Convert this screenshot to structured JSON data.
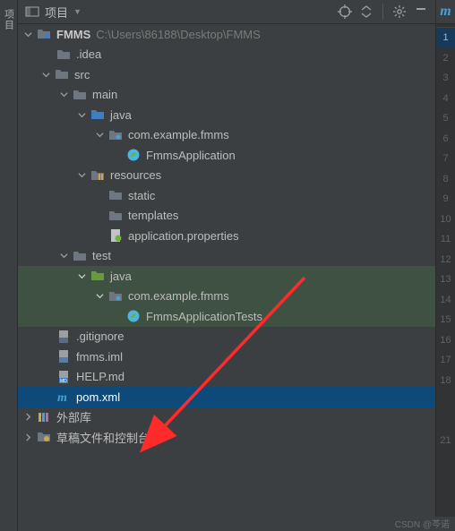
{
  "sidebar_tab": {
    "label": "项目"
  },
  "toolbar": {
    "title": "项目",
    "icons": {
      "project": "project-icon",
      "target": "target-icon",
      "expand": "expand-icon",
      "collapse": "collapse-icon",
      "settings": "gear-icon",
      "hide": "hide-icon"
    }
  },
  "gutter_tab": "m",
  "tree": {
    "root": {
      "name": "FMMS",
      "path": "C:\\Users\\86188\\Desktop\\FMMS",
      "children": [
        {
          "name": ".idea",
          "type": "dir"
        },
        {
          "name": "src",
          "type": "dir",
          "children": [
            {
              "name": "main",
              "type": "dir",
              "children": [
                {
                  "name": "java",
                  "type": "sourceRoot",
                  "children": [
                    {
                      "name": "com.example.fmms",
                      "type": "package",
                      "children": [
                        {
                          "name": "FmmsApplication",
                          "type": "springClass"
                        }
                      ]
                    }
                  ]
                },
                {
                  "name": "resources",
                  "type": "resourceRoot",
                  "children": [
                    {
                      "name": "static",
                      "type": "dir"
                    },
                    {
                      "name": "templates",
                      "type": "dir"
                    },
                    {
                      "name": "application.properties",
                      "type": "propsFile"
                    }
                  ]
                }
              ]
            },
            {
              "name": "test",
              "type": "dir",
              "children": [
                {
                  "name": "java",
                  "type": "testRoot",
                  "children": [
                    {
                      "name": "com.example.fmms",
                      "type": "package",
                      "children": [
                        {
                          "name": "FmmsApplicationTests",
                          "type": "springClass"
                        }
                      ]
                    }
                  ]
                }
              ]
            }
          ]
        },
        {
          "name": ".gitignore",
          "type": "gitFile"
        },
        {
          "name": "fmms.iml",
          "type": "imlFile"
        },
        {
          "name": "HELP.md",
          "type": "mdFile"
        },
        {
          "name": "pom.xml",
          "type": "mavenFile",
          "selected": true
        }
      ]
    },
    "extra": [
      {
        "name": "外部库",
        "type": "libs"
      },
      {
        "name": "草稿文件和控制台",
        "type": "scratches"
      }
    ]
  },
  "gutter_numbers": [
    "1",
    "2",
    "3",
    "4",
    "5",
    "6",
    "7",
    "8",
    "9",
    "10",
    "11",
    "12",
    "13",
    "14",
    "15",
    "16",
    "17",
    "18",
    "",
    "",
    "21"
  ],
  "gutter_highlight_index": 0,
  "watermark": "CSDN @芩诺"
}
